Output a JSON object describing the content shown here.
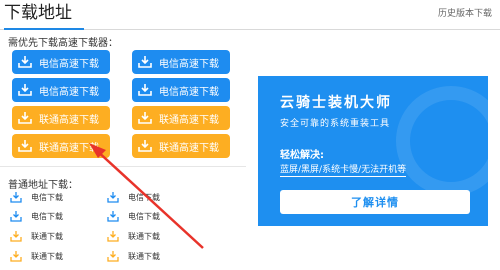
{
  "header": {
    "title": "下载地址",
    "history_link": "历史版本下载"
  },
  "fast_download": {
    "label": "需优先下载高速下载器：",
    "buttons": [
      {
        "label": "电信高速下载",
        "color": "#1e8cf0"
      },
      {
        "label": "电信高速下载",
        "color": "#1e8cf0"
      },
      {
        "label": "电信高速下载",
        "color": "#1e8cf0"
      },
      {
        "label": "电信高速下载",
        "color": "#1e8cf0"
      },
      {
        "label": "联通高速下载",
        "color": "#fdae22"
      },
      {
        "label": "联通高速下载",
        "color": "#fdae22"
      },
      {
        "label": "联通高速下载",
        "color": "#fdae22"
      },
      {
        "label": "联通高速下载",
        "color": "#fdae22"
      }
    ]
  },
  "normal_download": {
    "label": "普通地址下载：",
    "links": [
      {
        "label": "电信下载",
        "icon": "download-icon-blue"
      },
      {
        "label": "电信下载",
        "icon": "download-icon-blue"
      },
      {
        "label": "电信下载",
        "icon": "download-icon-blue"
      },
      {
        "label": "电信下载",
        "icon": "download-icon-blue"
      },
      {
        "label": "联通下载",
        "icon": "download-icon-orange"
      },
      {
        "label": "联通下载",
        "icon": "download-icon-orange"
      },
      {
        "label": "联通下载",
        "icon": "download-icon-orange"
      },
      {
        "label": "联通下载",
        "icon": "download-icon-orange"
      }
    ]
  },
  "promo": {
    "title": "云骑士装机大师",
    "subtitle": "安全可靠的系统重装工具",
    "solve_label": "轻松解决:",
    "problems": "蓝屏/黑屏/系统卡慢/无法开机等",
    "button_label": "了解详情",
    "background": "#1e8ff0"
  },
  "colors": {
    "accent_blue": "#1e8cf0",
    "accent_orange": "#fdae22",
    "arrow_red": "#e8332a"
  }
}
